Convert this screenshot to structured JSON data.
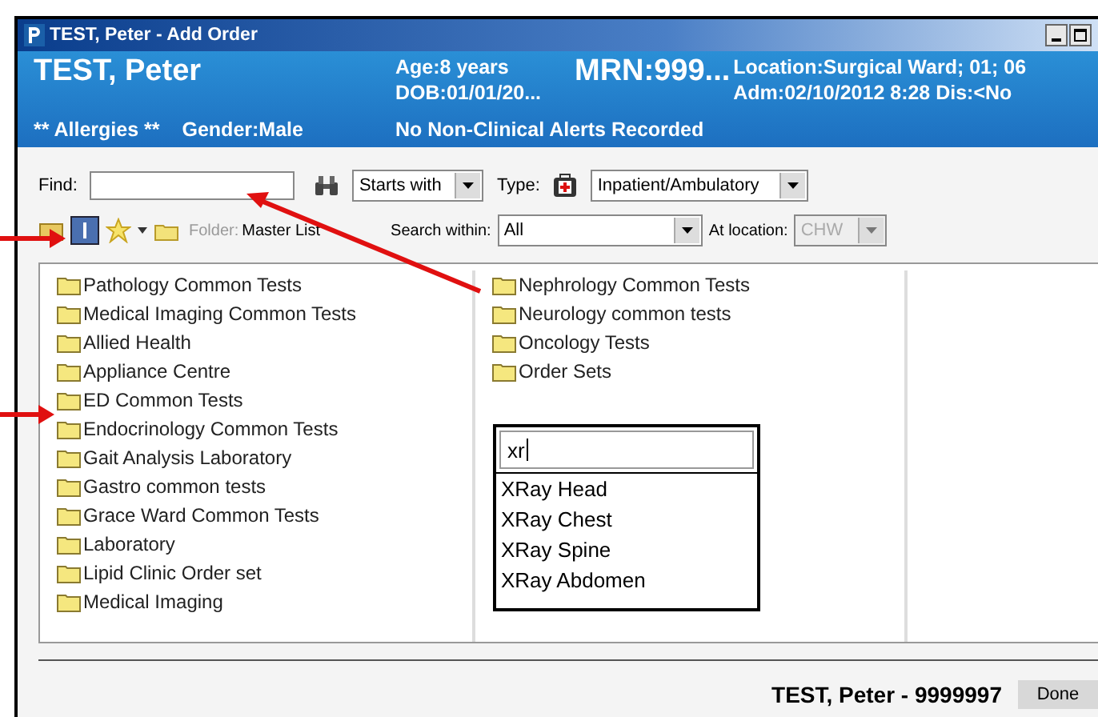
{
  "window": {
    "title": "TEST, Peter - Add Order"
  },
  "header": {
    "name": "TEST, Peter",
    "age": "Age:8 years",
    "dob": "DOB:01/01/20...",
    "mrn": "MRN:999...",
    "location": "Location:Surgical Ward; 01; 06",
    "admission": "Adm:02/10/2012 8:28 Dis:<No",
    "allergies": "** Allergies **",
    "gender": "Gender:Male",
    "alerts": "No Non-Clinical Alerts Recorded"
  },
  "toolbar": {
    "find_label": "Find:",
    "match": "Starts with",
    "type_label": "Type:",
    "type": "Inpatient/Ambulatory",
    "folder_label": "Folder:",
    "folder": "Master List",
    "search_within_label": "Search within:",
    "search_within": "All",
    "location_label": "At location:",
    "location": {
      "value": "CHW",
      "disabled": true
    }
  },
  "folders": [
    [
      "Pathology Common Tests",
      "Medical Imaging Common Tests",
      "Allied Health",
      "Appliance Centre",
      "ED Common Tests",
      "Endocrinology Common Tests",
      "Gait Analysis Laboratory",
      "Gastro common tests",
      "Grace Ward Common Tests",
      "Laboratory",
      "Lipid Clinic Order set",
      "Medical Imaging"
    ],
    [
      "Nephrology Common Tests",
      "Neurology common tests",
      "Oncology Tests",
      "Order Sets"
    ]
  ],
  "autocomplete": {
    "value": "xr",
    "items": [
      "XRay Head",
      "XRay Chest",
      "XRay Spine",
      "XRay Abdomen"
    ]
  },
  "footer": {
    "patient": "TEST, Peter - 9999997",
    "done": "Done"
  }
}
